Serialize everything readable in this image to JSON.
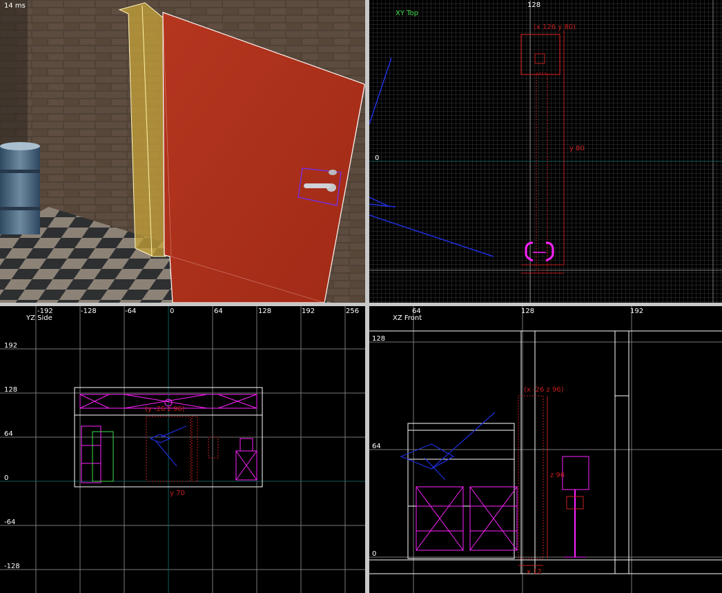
{
  "viewports": {
    "camera": {
      "frame_time": "14 ms"
    },
    "top": {
      "label": "XY Top",
      "h_ticks": [
        "128"
      ],
      "v_ticks": [
        "0"
      ]
    },
    "side": {
      "label": "YZ Side",
      "h_ticks": [
        "-192",
        "-128",
        "-64",
        "0",
        "64",
        "128",
        "192",
        "256"
      ],
      "v_ticks": [
        "192",
        "128",
        "64",
        "0",
        "-64",
        "-128"
      ]
    },
    "front": {
      "label": "XZ Front",
      "h_ticks": [
        "64",
        "128",
        "192"
      ],
      "v_ticks": [
        "128",
        "64",
        "0"
      ]
    }
  },
  "annotations": {
    "top_coord": "(x 126 y 80)",
    "top_size": "y 80",
    "side_coord": "(y -26 z 96)",
    "side_size": "y 70",
    "front_coord": "(x -26 z 96)",
    "front_size_z": "z 96",
    "front_size_x": "x 12"
  },
  "colors": {
    "viewport_bg": "#000000",
    "grid": "#3a3a3a",
    "grid_major": "#7a7a7a",
    "axis": "#0e5e5e",
    "label_green": "#3fe04a",
    "selection": "#c62020",
    "entity": "#ff22ff",
    "brush_blue": "#1f2fe0",
    "door_red": "#b8331f",
    "wall_brick": "#5a4a3c",
    "separator": "#c8c8c8"
  }
}
